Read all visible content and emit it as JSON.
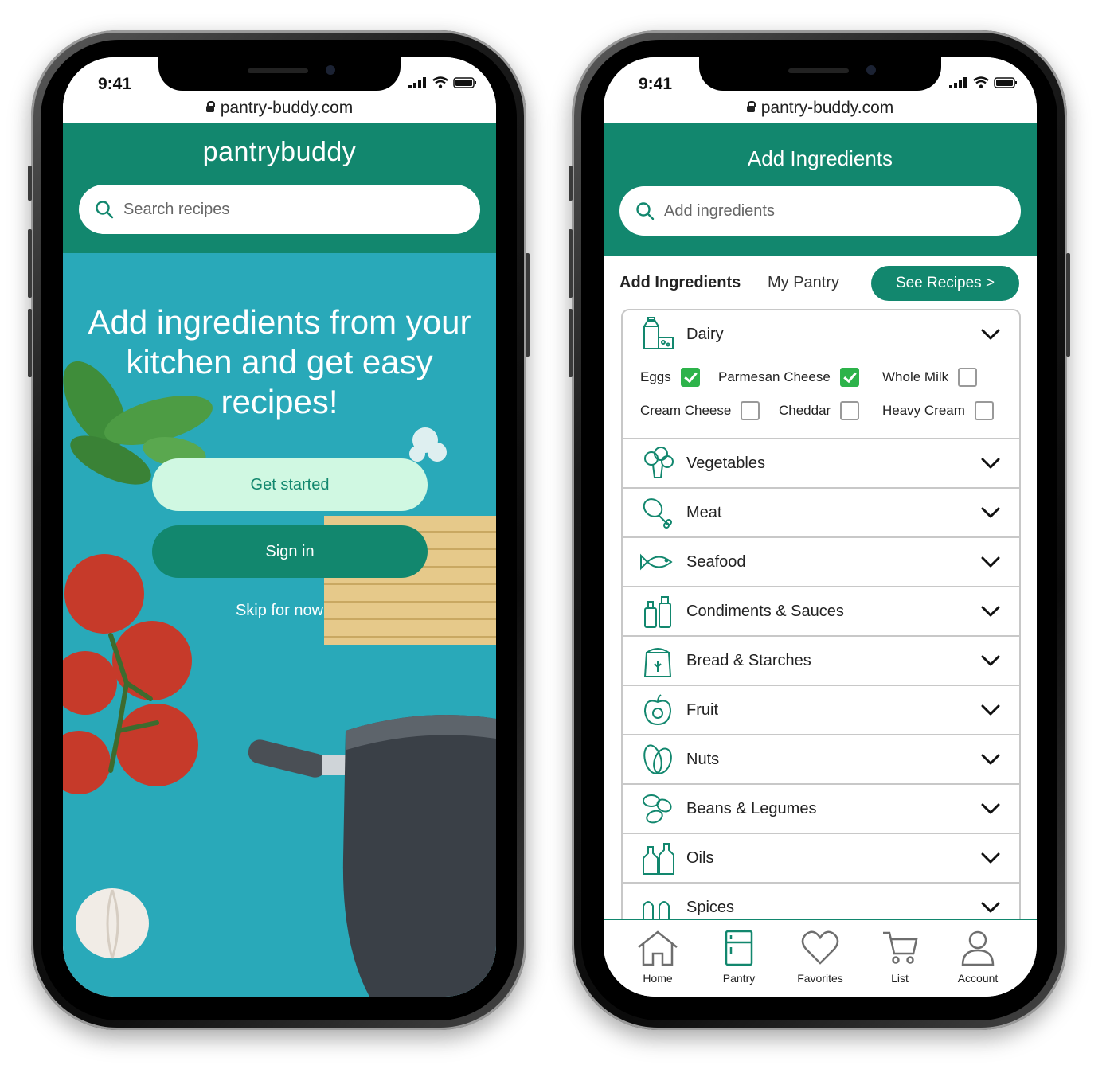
{
  "status": {
    "time": "9:41"
  },
  "browser": {
    "url": "pantry-buddy.com"
  },
  "colors": {
    "brand": "#12876e",
    "hero_bg": "#29a9b9",
    "cta_light": "#d0f8e2",
    "check": "#2db34a"
  },
  "landing": {
    "logo": "pantrybuddy",
    "search_placeholder": "Search recipes",
    "hero_title": "Add ingredients from your kitchen and get easy recipes!",
    "get_started": "Get started",
    "sign_in": "Sign in",
    "skip": "Skip for now"
  },
  "ingredients": {
    "title": "Add Ingredients",
    "search_placeholder": "Add ingredients",
    "tabs": [
      "Add Ingredients",
      "My Pantry"
    ],
    "see_recipes": "See Recipes >",
    "dairy": {
      "label": "Dairy",
      "icon": "milk-carton-icon",
      "items": [
        {
          "label": "Eggs",
          "checked": true
        },
        {
          "label": "Parmesan Cheese",
          "checked": true
        },
        {
          "label": "Whole Milk",
          "checked": false
        },
        {
          "label": "Cream Cheese",
          "checked": false
        },
        {
          "label": "Cheddar",
          "checked": false
        },
        {
          "label": "Heavy Cream",
          "checked": false
        }
      ]
    },
    "categories": [
      {
        "label": "Vegetables",
        "icon": "broccoli-icon"
      },
      {
        "label": "Meat",
        "icon": "drumstick-icon"
      },
      {
        "label": "Seafood",
        "icon": "fish-icon"
      },
      {
        "label": "Condiments & Sauces",
        "icon": "bottles-icon"
      },
      {
        "label": "Bread & Starches",
        "icon": "flour-bag-icon"
      },
      {
        "label": "Fruit",
        "icon": "apple-icon"
      },
      {
        "label": "Nuts",
        "icon": "almond-icon"
      },
      {
        "label": "Beans & Legumes",
        "icon": "beans-icon"
      },
      {
        "label": "Oils",
        "icon": "oil-bottles-icon"
      },
      {
        "label": "Spices",
        "icon": "shakers-icon"
      }
    ]
  },
  "tabbar": [
    {
      "label": "Home",
      "icon": "home-icon"
    },
    {
      "label": "Pantry",
      "icon": "fridge-icon"
    },
    {
      "label": "Favorites",
      "icon": "heart-icon"
    },
    {
      "label": "List",
      "icon": "cart-icon"
    },
    {
      "label": "Account",
      "icon": "user-icon"
    }
  ]
}
